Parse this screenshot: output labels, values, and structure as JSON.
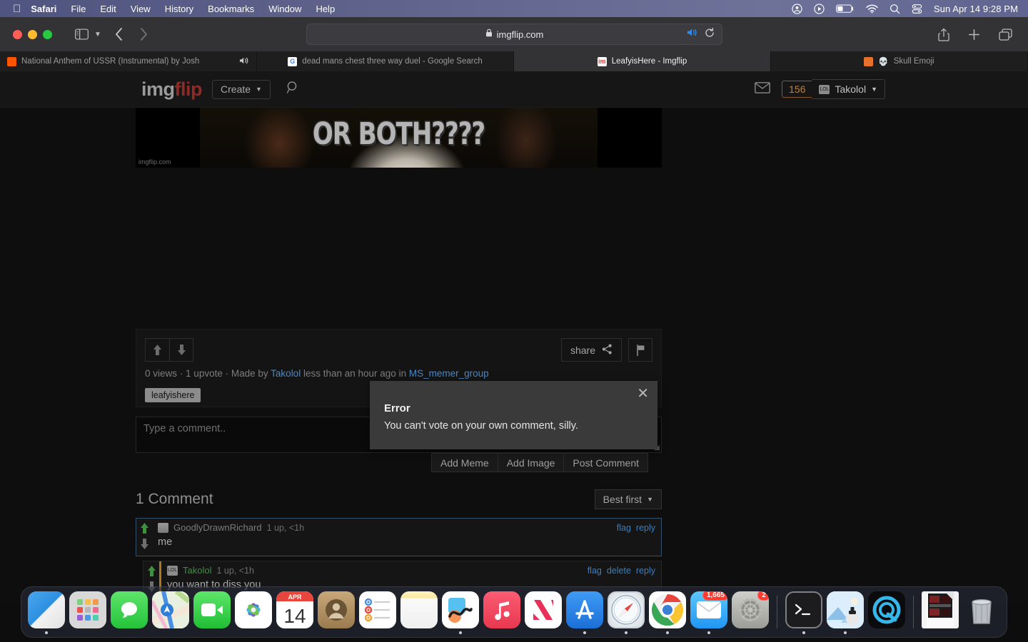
{
  "menubar": {
    "apple_icon": "apple-logo-icon",
    "items": [
      {
        "label": "Safari",
        "bold": true
      },
      {
        "label": "File",
        "bold": false
      },
      {
        "label": "Edit",
        "bold": false
      },
      {
        "label": "View",
        "bold": false
      },
      {
        "label": "History",
        "bold": false
      },
      {
        "label": "Bookmarks",
        "bold": false
      },
      {
        "label": "Window",
        "bold": false
      },
      {
        "label": "Help",
        "bold": false
      }
    ],
    "status_icons": [
      "user-account-icon",
      "control-play-icon",
      "battery-icon",
      "wifi-icon",
      "search-icon",
      "control-center-icon"
    ],
    "clock": "Sun Apr 14  9:28 PM"
  },
  "browser": {
    "window_controls": [
      "close-button",
      "minimize-button",
      "zoom-button"
    ],
    "sidebar_icon": "sidebar-toggle-icon",
    "back_icon": "chevron-left-icon",
    "forward_icon": "chevron-right-icon",
    "url": "imgflip.com",
    "lock_icon": "lock-icon",
    "audio_icon": "speaker-icon",
    "reload_icon": "reload-icon",
    "share_icon": "share-icon",
    "newtab_icon": "plus-icon",
    "tabs_overview_icon": "tab-overview-icon",
    "tabs": [
      {
        "title": "National Anthem of USSR (Instrumental) by Josh",
        "favicon": "soundcloud-icon",
        "active": false,
        "playing": true
      },
      {
        "title": "dead mans chest three way duel - Google Search",
        "favicon": "google-icon",
        "active": false,
        "playing": false
      },
      {
        "title": "LeafyisHere - Imgflip",
        "favicon": "imgflip-icon",
        "active": true,
        "playing": false
      },
      {
        "title": "Skull Emoji",
        "favicon": "emojipedia-icon",
        "active": false,
        "playing": false,
        "emoji": "💀"
      }
    ]
  },
  "site": {
    "logo_first": "img",
    "logo_second": "flip",
    "create_label": "Create",
    "search_icon": "search-icon",
    "messages_icon": "envelope-icon",
    "points": "156",
    "username": "Takolol",
    "user_badge_icon": "lol-badge-icon"
  },
  "meme": {
    "caption": "OR BOTH????",
    "watermark": "imgflip.com"
  },
  "post": {
    "upvote_icon": "arrow-up-icon",
    "downvote_icon": "arrow-down-icon",
    "share_label": "share",
    "share_icon": "share-nodes-icon",
    "flag_icon": "flag-icon",
    "views": "0 views",
    "sep": "·",
    "upvotes": "1 upvote",
    "made_by_prefix": "Made by",
    "author": "Takolol",
    "time": "less than an hour ago in",
    "stream": "MS_memer_group",
    "tag": "leafyishere"
  },
  "composer": {
    "placeholder": "Type a comment..",
    "value": "",
    "buttons": [
      "Add Meme",
      "Add Image",
      "Post Comment"
    ]
  },
  "comments": {
    "count_label": "1 Comment",
    "sort_label": "Best first",
    "items": [
      {
        "author": "GoodlyDrawnRichard",
        "author_color": "grey",
        "meta": "1 up, <1h",
        "text": "me",
        "actions": [
          "flag",
          "reply"
        ],
        "avatar": "user-avatar-icon",
        "is_reply": false
      },
      {
        "author": "Takolol",
        "author_color": "green",
        "meta": "1 up, <1h",
        "text": "you want to diss you",
        "actions": [
          "flag",
          "delete",
          "reply"
        ],
        "avatar": "lol-badge-icon",
        "is_reply": true
      }
    ]
  },
  "error_dialog": {
    "title": "Error",
    "message": "You can't vote on your own comment, silly.",
    "close_icon": "close-icon"
  },
  "dock": {
    "items": [
      {
        "name": "finder",
        "cls": "i-finder",
        "glyph": "",
        "running": true
      },
      {
        "name": "launchpad",
        "cls": "i-launchpad",
        "glyph": "",
        "running": false
      },
      {
        "name": "messages",
        "cls": "i-messages",
        "glyph": "💬",
        "running": false
      },
      {
        "name": "maps",
        "cls": "i-maps",
        "glyph": "",
        "running": false
      },
      {
        "name": "facetime",
        "cls": "i-facetime",
        "glyph": "📹",
        "running": false
      },
      {
        "name": "photos",
        "cls": "i-photos",
        "glyph": "",
        "running": false
      },
      {
        "name": "calendar",
        "cls": "i-calendar",
        "glyph": "",
        "running": false,
        "month": "APR",
        "day": "14"
      },
      {
        "name": "contacts",
        "cls": "i-contacts",
        "glyph": "",
        "running": false
      },
      {
        "name": "reminders",
        "cls": "i-reminders",
        "glyph": "",
        "running": false
      },
      {
        "name": "notes",
        "cls": "i-notes",
        "glyph": "",
        "running": false
      },
      {
        "name": "freeform",
        "cls": "i-freeform",
        "glyph": "",
        "running": true
      },
      {
        "name": "music",
        "cls": "i-music",
        "glyph": "♫",
        "running": false
      },
      {
        "name": "news",
        "cls": "i-news",
        "glyph": "",
        "running": false
      },
      {
        "name": "app-store",
        "cls": "i-appstore",
        "glyph": "",
        "running": true
      },
      {
        "name": "safari",
        "cls": "i-safari",
        "glyph": "",
        "running": true
      },
      {
        "name": "chrome",
        "cls": "i-chrome",
        "glyph": "",
        "running": true
      },
      {
        "name": "mail",
        "cls": "i-mail",
        "glyph": "✉",
        "running": true,
        "badge": "1,665"
      },
      {
        "name": "system-settings",
        "cls": "i-settings",
        "glyph": "",
        "running": false,
        "badge": "2"
      },
      {
        "name": "separator-1",
        "cls": "sep"
      },
      {
        "name": "terminal",
        "cls": "i-terminal",
        "glyph": "",
        "running": true
      },
      {
        "name": "preview",
        "cls": "i-preview",
        "glyph": "",
        "running": true
      },
      {
        "name": "quicktime-player",
        "cls": "i-quicktime",
        "glyph": "",
        "running": false
      },
      {
        "name": "separator-2",
        "cls": "sep"
      },
      {
        "name": "document",
        "cls": "i-doc",
        "glyph": "",
        "running": false
      },
      {
        "name": "trash",
        "cls": "i-trash",
        "glyph": "",
        "running": false
      }
    ]
  }
}
